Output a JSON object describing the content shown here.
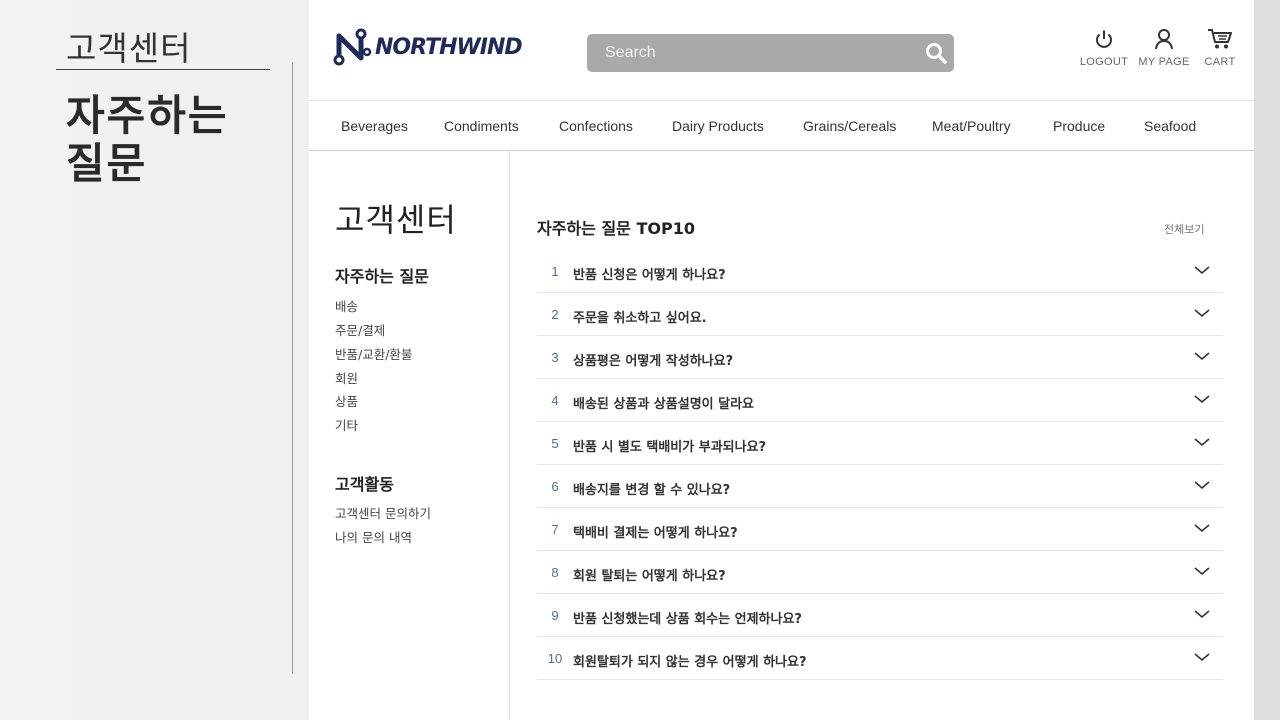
{
  "slide": {
    "subtitle": "고객센터",
    "title": "자주하는 질문"
  },
  "header": {
    "logo_text": "NORTHWIND",
    "search_placeholder": "Search",
    "utils": [
      {
        "label": "LOGOUT",
        "icon": "power-icon"
      },
      {
        "label": "MY PAGE",
        "icon": "user-icon"
      },
      {
        "label": "CART",
        "icon": "cart-icon"
      }
    ]
  },
  "nav": {
    "items": [
      "Beverages",
      "Condiments",
      "Confections",
      "Dairy Products",
      "Grains/Cereals",
      "Meat/Poultry",
      "Produce",
      "Seafood"
    ]
  },
  "sidebar": {
    "title": "고객센터",
    "sections": [
      {
        "heading": "자주하는 질문",
        "links": [
          "배송",
          "주문/결제",
          "반품/교환/환불",
          "회원",
          "상품",
          "기타"
        ]
      },
      {
        "heading": "고객활동",
        "links": [
          "고객센터 문의하기",
          "나의 문의 내역"
        ]
      }
    ]
  },
  "faq": {
    "title": "자주하는 질문 TOP10",
    "more_label": "전체보기",
    "items": [
      {
        "num": "1",
        "question": "반품 신청은 어떻게 하나요?"
      },
      {
        "num": "2",
        "question": "주문을 취소하고 싶어요."
      },
      {
        "num": "3",
        "question": "상품평은 어떻게 작성하나요?"
      },
      {
        "num": "4",
        "question": "배송된 상품과 상품설명이 달라요"
      },
      {
        "num": "5",
        "question": "반품 시 별도 택배비가 부과되나요?"
      },
      {
        "num": "6",
        "question": "배송지를 변경 할 수 있나요?"
      },
      {
        "num": "7",
        "question": "택배비 결제는 어떻게 하나요?"
      },
      {
        "num": "8",
        "question": "회원 탈퇴는 어떻게 하나요?"
      },
      {
        "num": "9",
        "question": "반품 신청했는데 상품 회수는 언제하나요?"
      },
      {
        "num": "10",
        "question": "회원탈퇴가 되지 않는 경우 어떻게 하나요?"
      }
    ]
  },
  "colors": {
    "logo": "#1f2a5c",
    "search_bg": "#a9a9a9",
    "faq_number": "#4a6ea9"
  }
}
